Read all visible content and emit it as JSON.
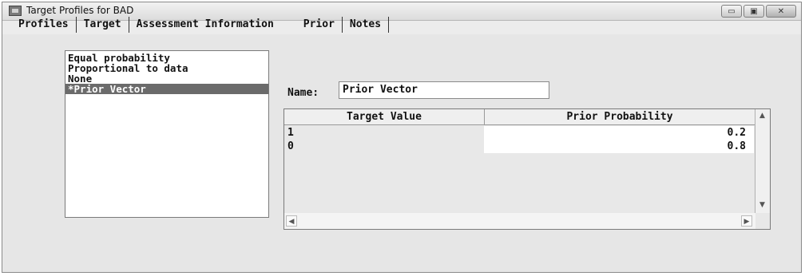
{
  "window": {
    "title": "Target Profiles for BAD",
    "buttons": {
      "minimize": "▭",
      "maximize": "▣",
      "close": "✕"
    }
  },
  "tabs": [
    {
      "label": "Profiles"
    },
    {
      "label": "Target"
    },
    {
      "label": "Assessment Information"
    },
    {
      "label": "Prior"
    },
    {
      "label": "Notes"
    }
  ],
  "prior_list": {
    "items": [
      {
        "label": "Equal probability",
        "selected": false
      },
      {
        "label": "Proportional to data",
        "selected": false
      },
      {
        "label": "None",
        "selected": false
      },
      {
        "label": "*Prior Vector",
        "selected": true
      }
    ]
  },
  "name_field": {
    "label": "Name:",
    "value": "Prior Vector"
  },
  "prior_table": {
    "columns": [
      "Target Value",
      "Prior Probability"
    ],
    "rows": [
      {
        "target_value": "1",
        "prior_probability": "0.2"
      },
      {
        "target_value": "0",
        "prior_probability": "0.8"
      }
    ]
  },
  "icons": {
    "app": "sas-app-icon",
    "scroll_up": "▲",
    "scroll_down": "▼",
    "scroll_left": "◀",
    "scroll_right": "▶"
  }
}
